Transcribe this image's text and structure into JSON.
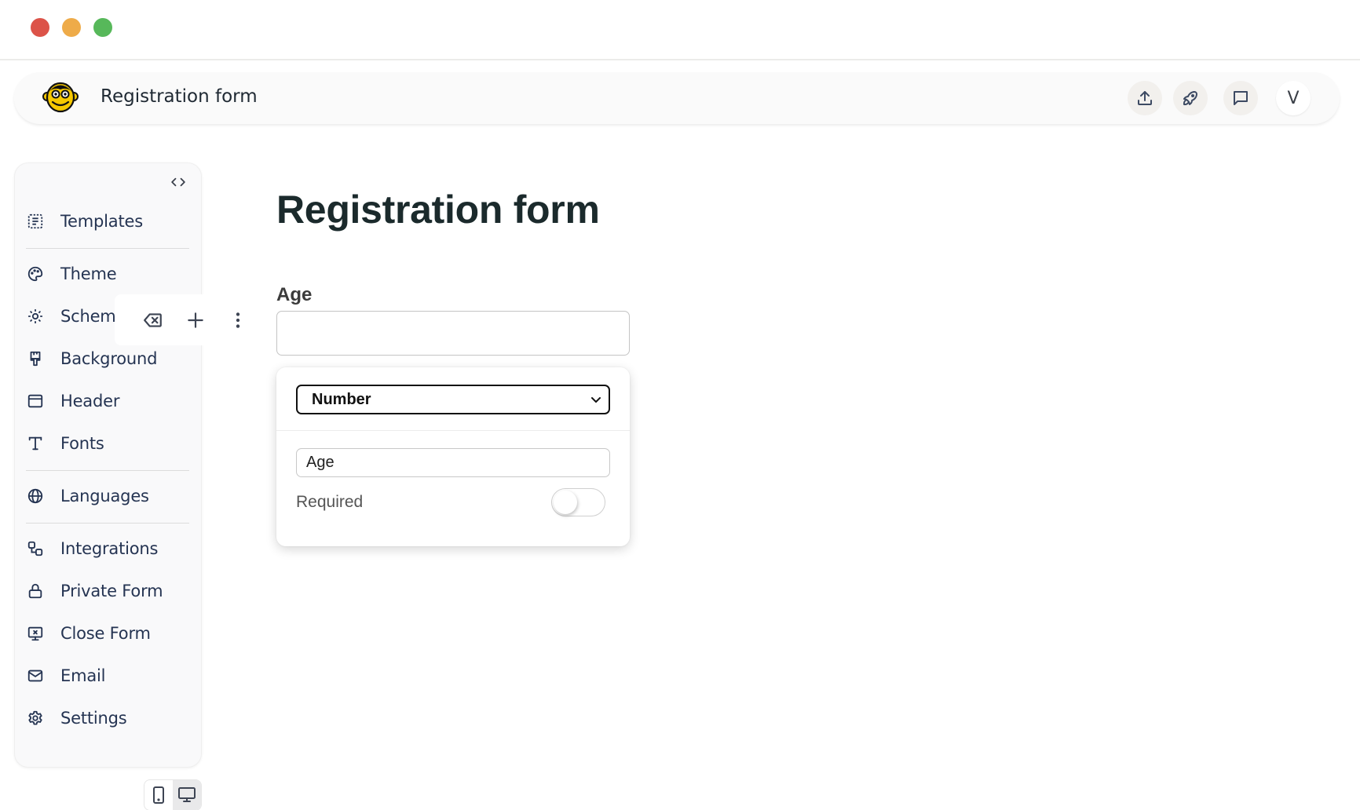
{
  "window": {
    "controls": [
      "close",
      "minimize",
      "maximize"
    ]
  },
  "appbar": {
    "logo_icon": "monkey-face-icon",
    "title": "Registration form",
    "actions": [
      {
        "name": "share",
        "icon": "upload-icon"
      },
      {
        "name": "publish",
        "icon": "rocket-icon"
      },
      {
        "name": "feedback",
        "icon": "chat-bubble-icon"
      }
    ],
    "avatar_initial": "V"
  },
  "sidebar": {
    "collapse_icon": "code-brackets-icon",
    "items": [
      {
        "label": "Templates",
        "icon": "templates-icon"
      },
      {
        "label": "Theme",
        "icon": "palette-icon"
      },
      {
        "label": "Scheme",
        "icon": "sun-icon"
      },
      {
        "label": "Background",
        "icon": "paintbrush-icon"
      },
      {
        "label": "Header",
        "icon": "layout-header-icon"
      },
      {
        "label": "Fonts",
        "icon": "typography-icon"
      },
      {
        "label": "Languages",
        "icon": "globe-icon"
      },
      {
        "label": "Integrations",
        "icon": "integrations-icon"
      },
      {
        "label": "Private Form",
        "icon": "lock-icon"
      },
      {
        "label": "Close Form",
        "icon": "screen-close-icon"
      },
      {
        "label": "Email",
        "icon": "mail-icon"
      },
      {
        "label": "Settings",
        "icon": "gear-icon"
      }
    ]
  },
  "field_toolbar": {
    "actions": [
      "delete",
      "add",
      "more"
    ]
  },
  "device_toggle": {
    "options": [
      "mobile",
      "desktop"
    ],
    "selected": "desktop"
  },
  "form": {
    "title": "Registration form",
    "field": {
      "label": "Age",
      "value": ""
    },
    "field_settings": {
      "type_selected": "Number",
      "label_value": "Age",
      "required_label": "Required",
      "required": false
    }
  },
  "colors": {
    "close": "#dc5349",
    "minimize": "#eeab49",
    "maximize": "#57b85a",
    "icon": "#253452",
    "logo_yellow": "#f6c800"
  }
}
